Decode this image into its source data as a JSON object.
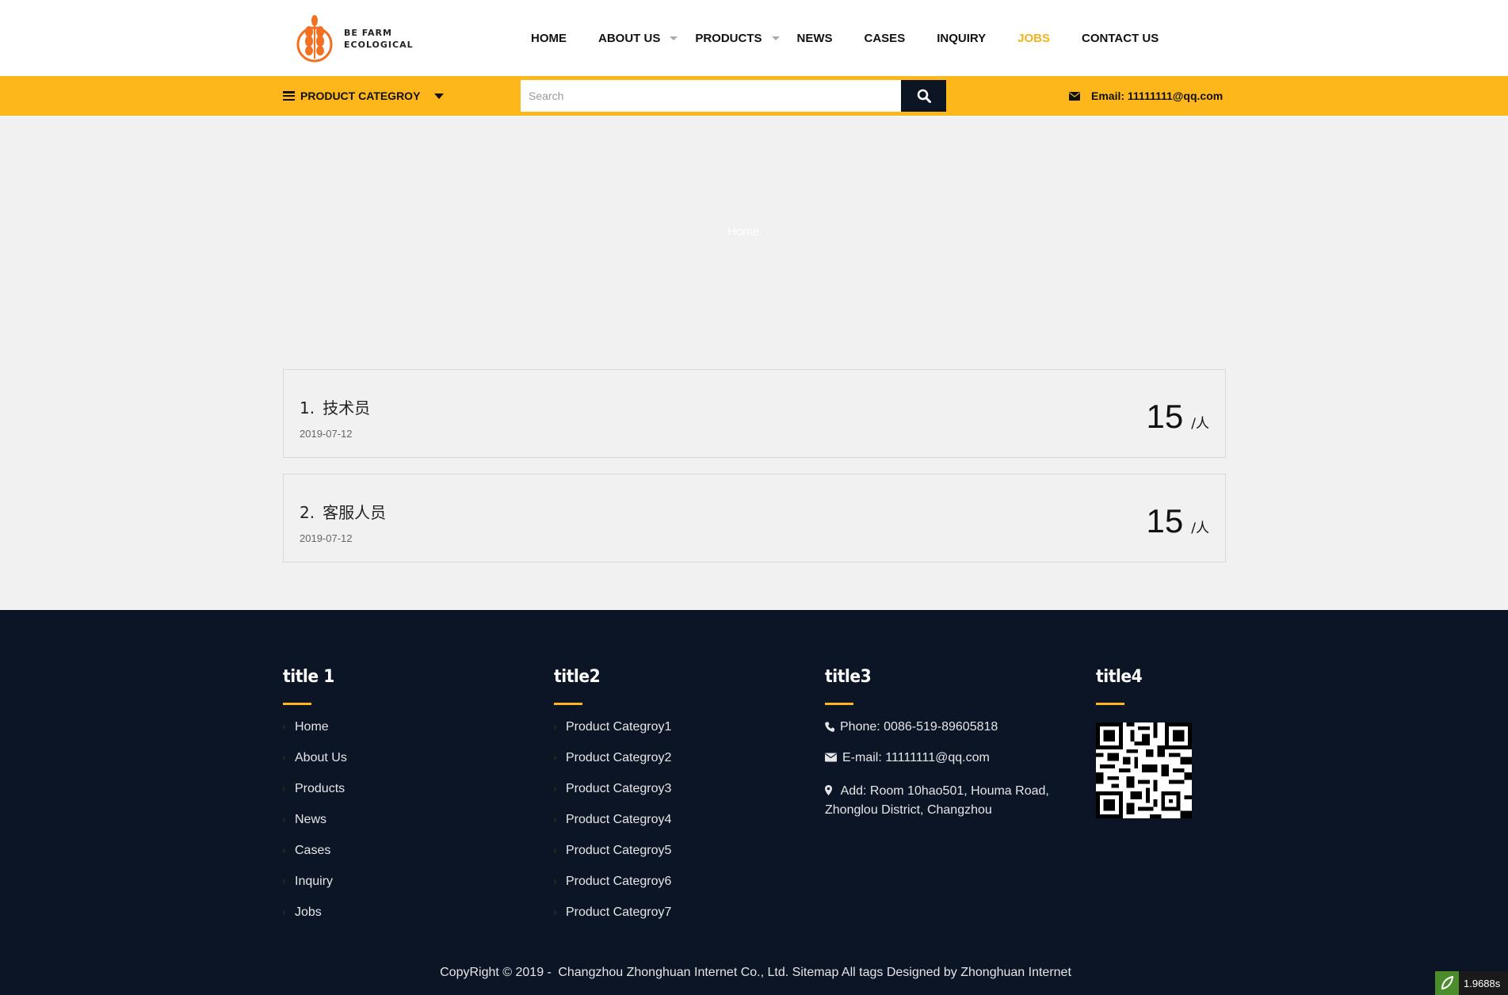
{
  "header": {
    "logo_line1": "BE FARM",
    "logo_line2": "ECOLOGICAL",
    "nav": [
      {
        "label": "HOME",
        "has_dropdown": false,
        "active": false
      },
      {
        "label": "ABOUT US",
        "has_dropdown": true,
        "active": false
      },
      {
        "label": "PRODUCTS",
        "has_dropdown": true,
        "active": false
      },
      {
        "label": "NEWS",
        "has_dropdown": false,
        "active": false
      },
      {
        "label": "CASES",
        "has_dropdown": false,
        "active": false
      },
      {
        "label": "INQUIRY",
        "has_dropdown": false,
        "active": false
      },
      {
        "label": "JOBS",
        "has_dropdown": false,
        "active": true
      },
      {
        "label": "CONTACT US",
        "has_dropdown": false,
        "active": false
      }
    ]
  },
  "topbar": {
    "category_label": "PRODUCT CATEGROY",
    "search_placeholder": "Search",
    "search_value": "",
    "email_label": "Email: 11111111@qq.com"
  },
  "breadcrumb": {
    "home": "Home",
    "separator": "›"
  },
  "jobs": [
    {
      "number": "1.",
      "title": "技术员",
      "date": "2019-07-12",
      "count": "15",
      "unit": "/人"
    },
    {
      "number": "2.",
      "title": "客服人员",
      "date": "2019-07-12",
      "count": "15",
      "unit": "/人"
    }
  ],
  "footer": {
    "col1": {
      "title": "title 1",
      "links": [
        "Home",
        "About Us",
        "Products",
        "News",
        "Cases",
        "Inquiry",
        "Jobs"
      ]
    },
    "col2": {
      "title": "title2",
      "links": [
        "Product Categroy1",
        "Product Categroy2",
        "Product Categroy3",
        "Product Categroy4",
        "Product Categroy5",
        "Product Categroy6",
        "Product Categroy7"
      ]
    },
    "col3": {
      "title": "title3",
      "phone": "Phone: 0086-519-89605818",
      "email": "E-mail: 11111111@qq.com",
      "address": "Add: Room 10hao501, Houma Road, Zhonglou District, Changzhou"
    },
    "col4": {
      "title": "title4"
    },
    "copyright": "CopyRight © 2019 -",
    "company": "Changzhou Zhonghuan Internet Co., Ltd.",
    "sitemap": "Sitemap",
    "alltags": "All tags",
    "designed": "Designed by Zhonghuan Internet"
  },
  "timer": "1.9688s",
  "colors": {
    "accent": "#fdb71b",
    "dark": "#0b1526",
    "logo_orange": "#f36f21"
  }
}
